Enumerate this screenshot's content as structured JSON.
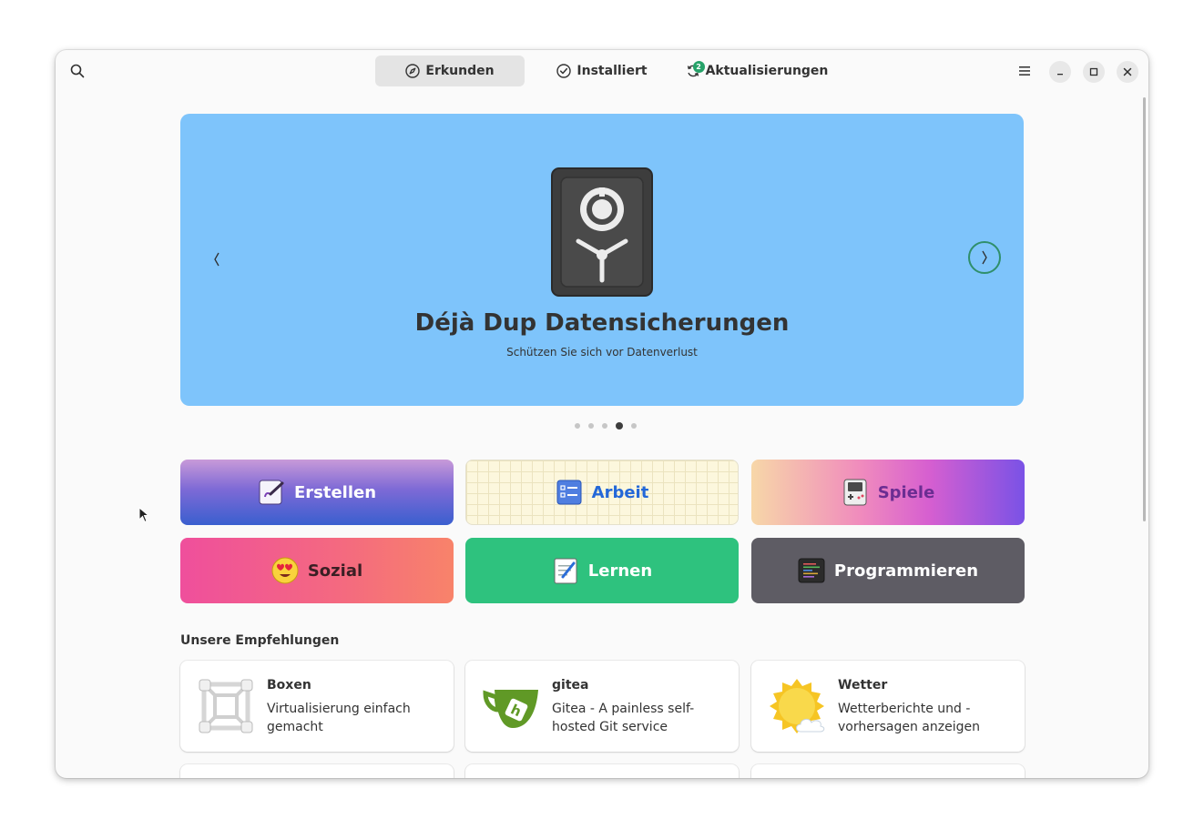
{
  "header": {
    "tabs": [
      {
        "label": "Erkunden",
        "icon": "compass-icon",
        "active": true
      },
      {
        "label": "Installiert",
        "icon": "check-circle-icon",
        "active": false
      },
      {
        "label": "Aktualisierungen",
        "icon": "refresh-icon",
        "active": false,
        "badge": "2"
      }
    ]
  },
  "carousel": {
    "title": "Déjà Dup Datensicherungen",
    "subtitle": "Schützen Sie sich vor Datenverlust",
    "background": "#7ec4fb",
    "slide_count": 5,
    "active_slide": 4
  },
  "categories": [
    {
      "label": "Erstellen",
      "icon": "paint-brush-icon"
    },
    {
      "label": "Arbeit",
      "icon": "checklist-icon"
    },
    {
      "label": "Spiele",
      "icon": "gameboy-icon"
    },
    {
      "label": "Sozial",
      "icon": "heart-eyes-emoji-icon"
    },
    {
      "label": "Lernen",
      "icon": "notepad-icon"
    },
    {
      "label": "Programmieren",
      "icon": "code-editor-icon"
    }
  ],
  "recommendations": {
    "title": "Unsere Empfehlungen",
    "items": [
      {
        "name": "Boxen",
        "description": "Virtualisierung einfach gemacht",
        "icon": "boxes-icon"
      },
      {
        "name": "gitea",
        "description": "Gitea - A painless self-hosted Git service",
        "icon": "gitea-teacup-icon"
      },
      {
        "name": "Wetter",
        "description": "Wetterberichte und -vorhersagen anzeigen",
        "icon": "sun-cloud-icon"
      }
    ]
  },
  "colors": {
    "accent_green": "#26a269",
    "lernen_green": "#2ec27e",
    "programmieren_gray": "#5e5c64"
  }
}
